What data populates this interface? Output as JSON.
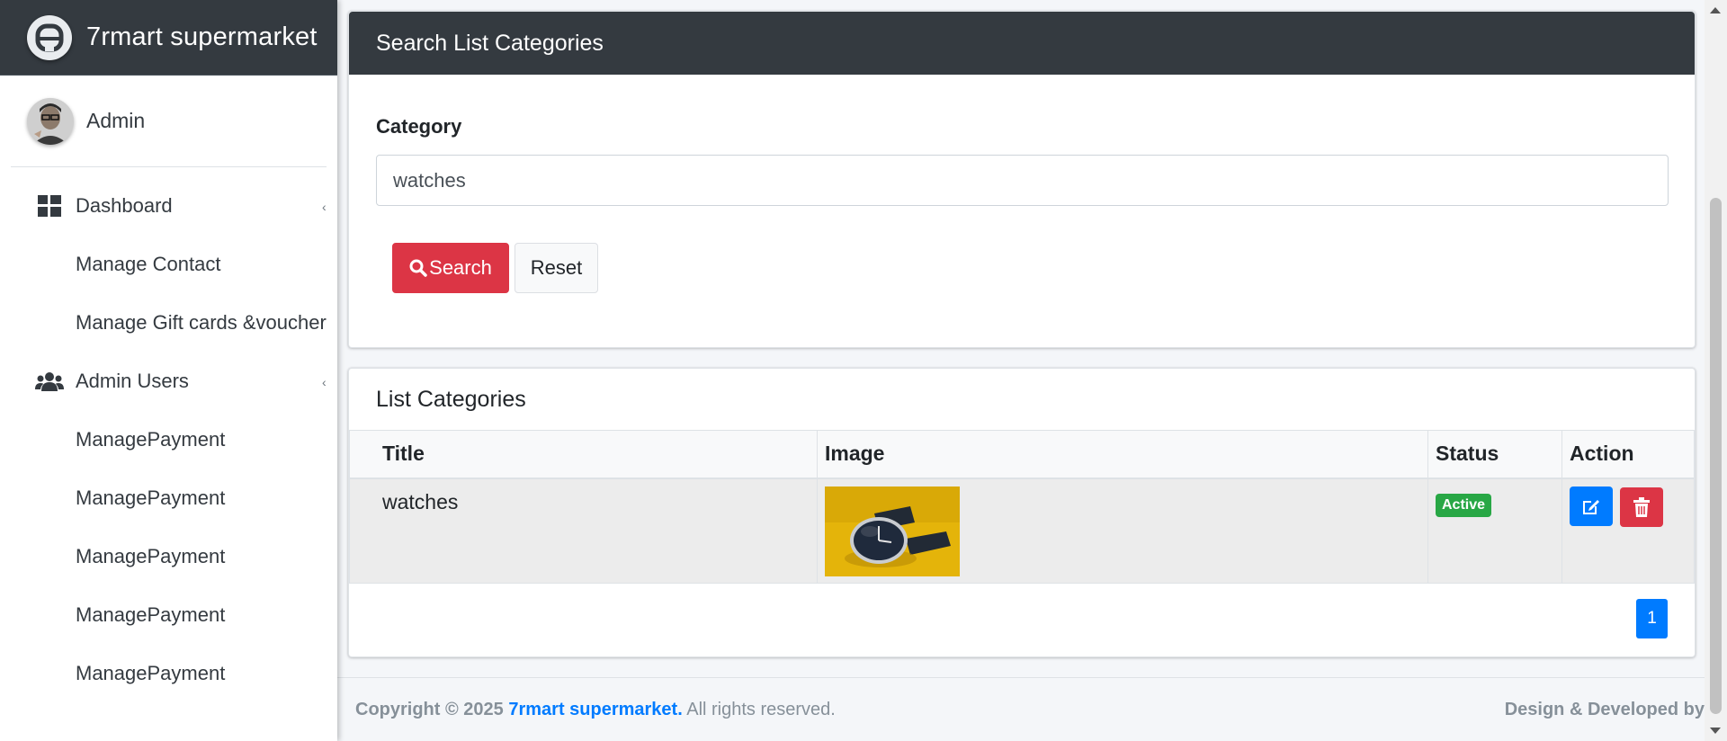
{
  "brand": {
    "name": "7rmart supermarket"
  },
  "user": {
    "name": "Admin"
  },
  "sidebar": {
    "items": [
      {
        "label": "Dashboard",
        "icon": "dashboard-icon",
        "has_caret": true
      },
      {
        "label": "Manage Contact"
      },
      {
        "label": "Manage Gift cards &voucher"
      },
      {
        "label": "Admin Users",
        "icon": "users-icon",
        "has_caret": true
      },
      {
        "label": "ManagePayment"
      },
      {
        "label": "ManagePayment"
      },
      {
        "label": "ManagePayment"
      },
      {
        "label": "ManagePayment"
      },
      {
        "label": "ManagePayment"
      }
    ]
  },
  "search_card": {
    "title": "Search List Categories",
    "field_label": "Category",
    "input_value": "watches",
    "search_label": "Search",
    "reset_label": "Reset"
  },
  "list_card": {
    "title": "List Categories",
    "columns": [
      "Title",
      "Image",
      "Status",
      "Action"
    ],
    "rows": [
      {
        "title": "watches",
        "image": "wristwatch-thumbnail",
        "status": "Active"
      }
    ],
    "page": "1"
  },
  "footer": {
    "copyright": "Copyright © 2025",
    "brand_link": "7rmart supermarket.",
    "rights": "All rights reserved.",
    "right_text": "Design & Developed by"
  },
  "colors": {
    "header_dark": "#343a40",
    "danger": "#dc3545",
    "primary": "#007bff",
    "success": "#28a745"
  }
}
